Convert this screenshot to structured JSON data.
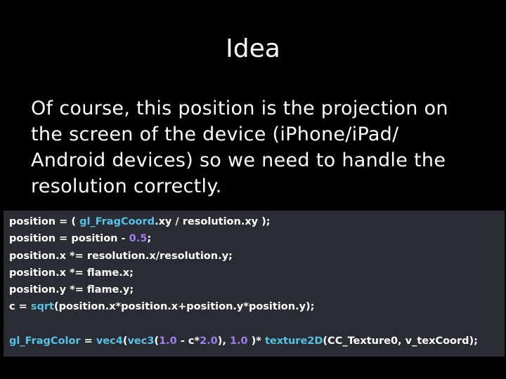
{
  "slide": {
    "title": "Idea",
    "body_lines": [
      "Of course, this position is the projection on",
      "the screen of the device (iPhone/iPad/",
      "Android devices) so we need to handle the",
      "resolution correctly."
    ]
  },
  "colors": {
    "background": "#000000",
    "code_background": "#2a2c34",
    "plain": "#ffffff",
    "builtin": "#56c2e6",
    "number": "#a57cf2"
  },
  "code": {
    "lines": [
      [
        {
          "text": "position = ( ",
          "kind": "plain"
        },
        {
          "text": "gl_FragCoord",
          "kind": "builtin"
        },
        {
          "text": ".xy / resolution.xy );",
          "kind": "plain"
        }
      ],
      [
        {
          "text": "position = position - ",
          "kind": "plain"
        },
        {
          "text": "0.5",
          "kind": "number"
        },
        {
          "text": ";",
          "kind": "plain"
        }
      ],
      [
        {
          "text": "position.x *= resolution.x/resolution.y;",
          "kind": "plain"
        }
      ],
      [
        {
          "text": "position.x *= flame.x;",
          "kind": "plain"
        }
      ],
      [
        {
          "text": "position.y *= flame.y;",
          "kind": "plain"
        }
      ],
      [
        {
          "text": "c = ",
          "kind": "plain"
        },
        {
          "text": "sqrt",
          "kind": "builtin"
        },
        {
          "text": "(position.x*position.x+position.y*position.y);",
          "kind": "plain"
        }
      ],
      [],
      [
        {
          "text": "gl_FragColor",
          "kind": "builtin"
        },
        {
          "text": " = ",
          "kind": "plain"
        },
        {
          "text": "vec4",
          "kind": "builtin"
        },
        {
          "text": "(",
          "kind": "plain"
        },
        {
          "text": "vec3",
          "kind": "builtin"
        },
        {
          "text": "(",
          "kind": "plain"
        },
        {
          "text": "1.0",
          "kind": "number"
        },
        {
          "text": " - c*",
          "kind": "plain"
        },
        {
          "text": "2.0",
          "kind": "number"
        },
        {
          "text": "), ",
          "kind": "plain"
        },
        {
          "text": "1.0",
          "kind": "number"
        },
        {
          "text": " )* ",
          "kind": "plain"
        },
        {
          "text": "texture2D",
          "kind": "builtin"
        },
        {
          "text": "(CC_Texture0, v_texCoord);",
          "kind": "plain"
        }
      ]
    ]
  }
}
